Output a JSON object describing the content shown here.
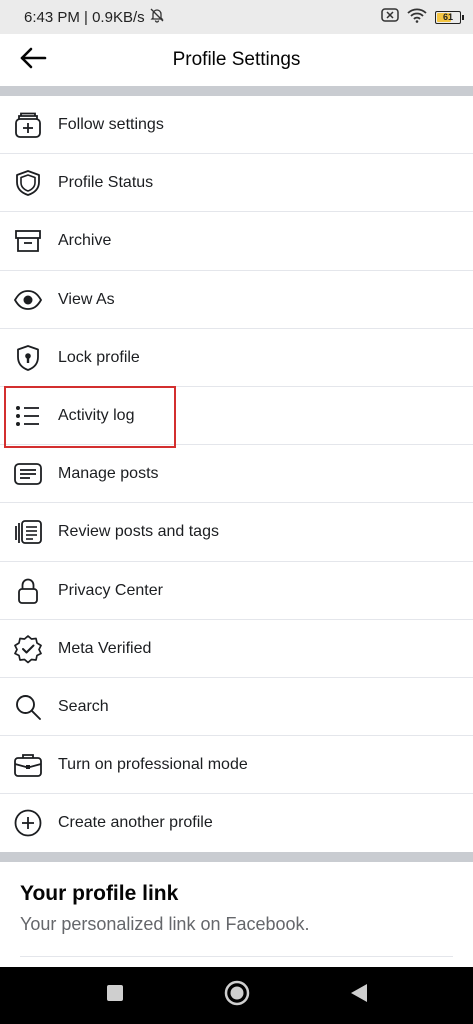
{
  "status_bar": {
    "time_network": "6:43 PM | 0.9KB/s",
    "battery_level": "61"
  },
  "header": {
    "title": "Profile Settings"
  },
  "menu": {
    "items": [
      {
        "label": "Follow settings",
        "icon": "follow-settings-icon"
      },
      {
        "label": "Profile Status",
        "icon": "shield-icon"
      },
      {
        "label": "Archive",
        "icon": "archive-box-icon"
      },
      {
        "label": "View As",
        "icon": "eye-icon"
      },
      {
        "label": "Lock profile",
        "icon": "lock-shield-icon"
      },
      {
        "label": "Activity log",
        "icon": "list-icon"
      },
      {
        "label": "Manage posts",
        "icon": "posts-card-icon"
      },
      {
        "label": "Review posts and tags",
        "icon": "review-tags-icon"
      },
      {
        "label": "Privacy Center",
        "icon": "padlock-icon"
      },
      {
        "label": "Meta Verified",
        "icon": "verified-badge-icon"
      },
      {
        "label": "Search",
        "icon": "search-icon"
      },
      {
        "label": "Turn on professional mode",
        "icon": "briefcase-icon"
      },
      {
        "label": "Create another profile",
        "icon": "plus-circle-icon"
      }
    ],
    "highlighted_item": "Activity log",
    "highlight_color": "#d32f2f"
  },
  "profile_link": {
    "title": "Your profile link",
    "subtitle": "Your personalized link on Facebook."
  }
}
